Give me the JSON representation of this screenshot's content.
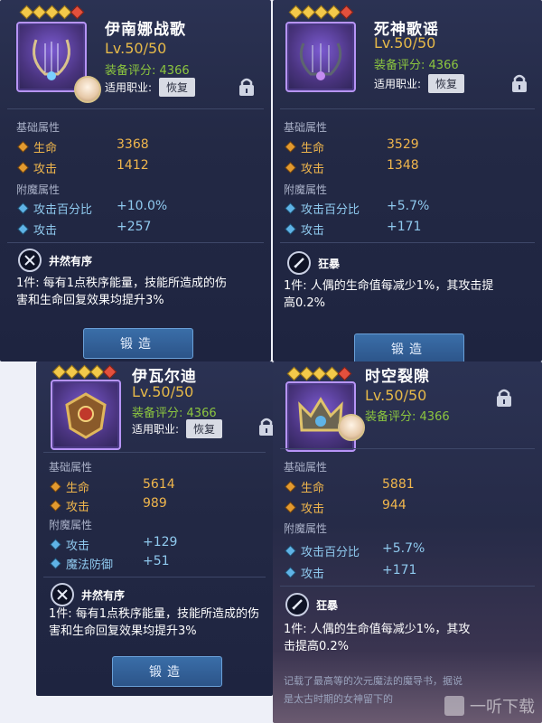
{
  "cards": [
    {
      "name": "伊南娜战歌",
      "level": "Lv.50/50",
      "score_label": "装备评分:",
      "score_value": "4366",
      "job_label": "适用职业:",
      "job_btn": "恢复",
      "base_title": "基础属性",
      "base": [
        {
          "label": "生命",
          "value": "3368"
        },
        {
          "label": "攻击",
          "value": "1412"
        }
      ],
      "ench_title": "附魔属性",
      "ench": [
        {
          "label": "攻击百分比",
          "value": "+10.0%"
        },
        {
          "label": "攻击",
          "value": "+257"
        }
      ],
      "skill_name": "井然有序",
      "skill_line1": "1件: 每有1点秩序能量，技能所造成的伤",
      "skill_line2": "害和生命回复效果均提升3%",
      "forge": "锻造"
    },
    {
      "name": "死神歌谣",
      "level": "Lv.50/50",
      "score_label": "装备评分:",
      "score_value": "4366",
      "job_label": "适用职业:",
      "job_btn": "恢复",
      "base_title": "基础属性",
      "base": [
        {
          "label": "生命",
          "value": "3529"
        },
        {
          "label": "攻击",
          "value": "1348"
        }
      ],
      "ench_title": "附魔属性",
      "ench": [
        {
          "label": "攻击百分比",
          "value": "+5.7%"
        },
        {
          "label": "攻击",
          "value": "+171"
        }
      ],
      "skill_name": "狂暴",
      "skill_line1": "1件: 人偶的生命值每减少1%，其攻击提",
      "skill_line2": "高0.2%",
      "forge": "锻造"
    },
    {
      "name": "伊瓦尔迪",
      "level": "Lv.50/50",
      "score_label": "装备评分:",
      "score_value": "4366",
      "job_label": "适用职业:",
      "job_btn": "恢复",
      "base_title": "基础属性",
      "base": [
        {
          "label": "生命",
          "value": "5614"
        },
        {
          "label": "攻击",
          "value": "989"
        }
      ],
      "ench_title": "附魔属性",
      "ench": [
        {
          "label": "攻击",
          "value": "+129"
        },
        {
          "label": "魔法防御",
          "value": "+51"
        }
      ],
      "skill_name": "井然有序",
      "skill_line1": "1件: 每有1点秩序能量，技能所造成的伤",
      "skill_line2": "害和生命回复效果均提升3%",
      "forge": "锻造"
    },
    {
      "name": "时空裂隙",
      "level": "Lv.50/50",
      "score_label": "装备评分:",
      "score_value": "4366",
      "base_title": "基础属性",
      "base": [
        {
          "label": "生命",
          "value": "5881"
        },
        {
          "label": "攻击",
          "value": "944"
        }
      ],
      "ench_title": "附魔属性",
      "ench": [
        {
          "label": "攻击百分比",
          "value": "+5.7%"
        },
        {
          "label": "攻击",
          "value": "+171"
        }
      ],
      "skill_name": "狂暴",
      "skill_line1": "1件: 人偶的生命值每减少1%，其攻",
      "skill_line2": "击提高0.2%",
      "flavor1": "记载了最高等的次元魔法的魔导书，据说",
      "flavor2": "是太古时期的女神留下的"
    }
  ],
  "watermark": "一听下载",
  "colors": {
    "gold": "#f0b64c",
    "green": "#8cc63f",
    "blue": "#8fc9ee",
    "purple": "#b794f6"
  }
}
